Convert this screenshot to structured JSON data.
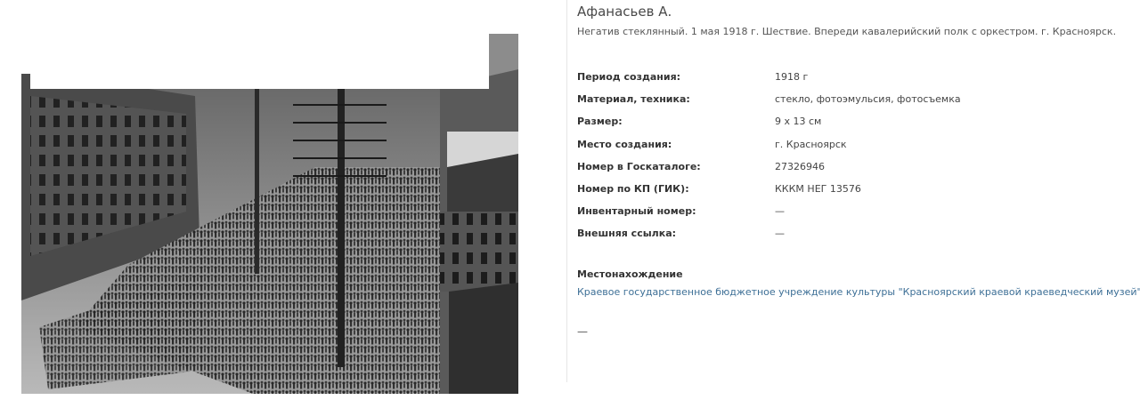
{
  "author": "Афанасьев А.",
  "description": "Негатив стеклянный. 1 мая 1918 г. Шествие. Впереди кавалерийский полк с оркестром. г. Красноярск.",
  "properties": [
    {
      "label": "Период создания:",
      "value": "1918 г"
    },
    {
      "label": "Материал, техника:",
      "value": "стекло, фотоэмульсия, фотосъемка"
    },
    {
      "label": "Размер:",
      "value": "9 х 13 см"
    },
    {
      "label": "Место создания:",
      "value": "г. Красноярск"
    },
    {
      "label": "Номер в Госкаталоге:",
      "value": "27326946"
    },
    {
      "label": "Номер по КП (ГИК):",
      "value": "КККМ НЕГ 13576"
    },
    {
      "label": "Инвентарный номер:",
      "value": "—"
    },
    {
      "label": "Внешняя ссылка:",
      "value": "—"
    }
  ],
  "location": {
    "title": "Местонахождение",
    "link": "Краевое государственное бюджетное учреждение культуры \"Красноярский краевой краеведческий музей\""
  },
  "footer_dash": "—",
  "colors": {
    "link": "#3d6f96",
    "text": "#3b3b3b"
  }
}
